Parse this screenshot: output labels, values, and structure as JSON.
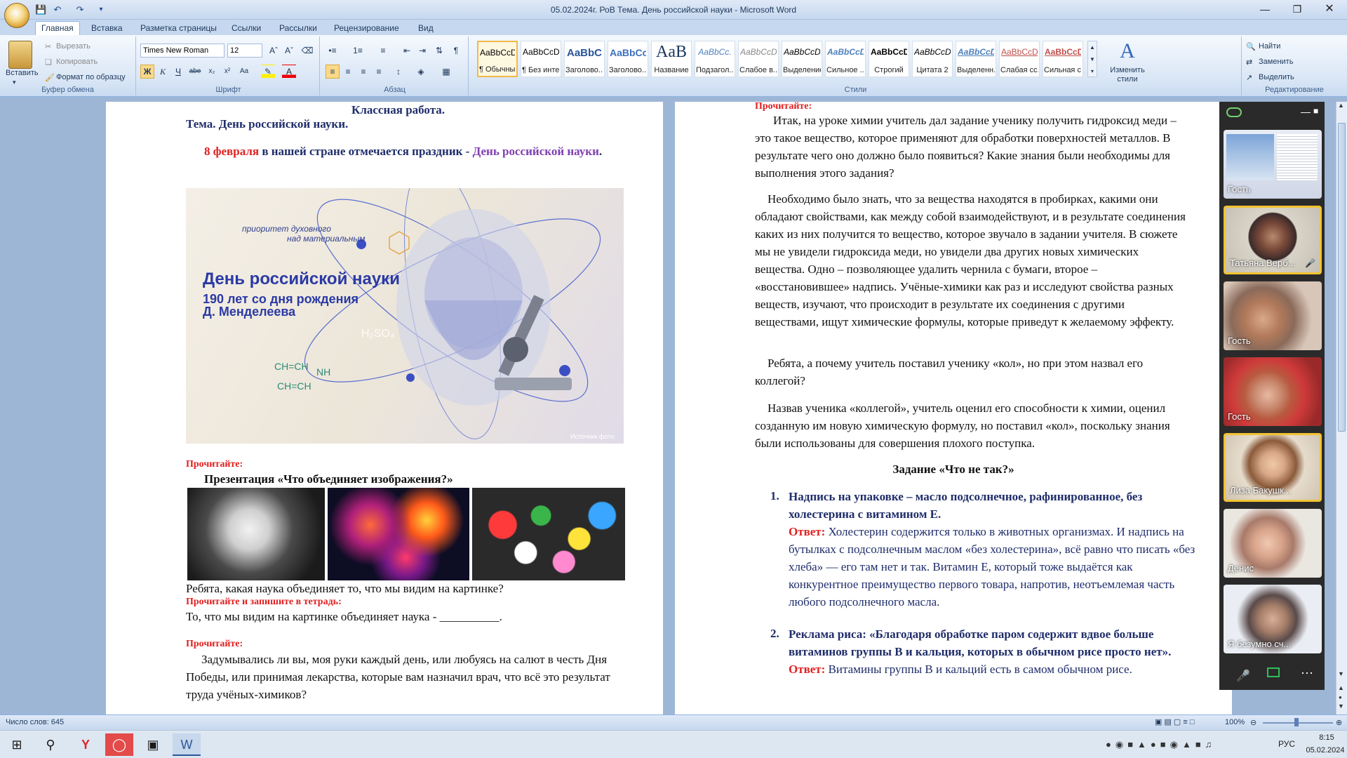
{
  "window": {
    "title": "05.02.2024г. РоВ Тема. День российской науки - Microsoft Word"
  },
  "qat": {
    "save_icon": "save-icon",
    "undo_icon": "undo-icon",
    "redo_icon": "redo-icon"
  },
  "tabs": [
    "Главная",
    "Вставка",
    "Разметка страницы",
    "Ссылки",
    "Рассылки",
    "Рецензирование",
    "Вид"
  ],
  "ribbon": {
    "clipboard": {
      "label": "Буфер обмена",
      "paste": "Вставить",
      "cut": "Вырезать",
      "copy": "Копировать",
      "format": "Формат по образцу"
    },
    "font": {
      "label": "Шрифт",
      "name": "Times New Roman",
      "size": "12"
    },
    "paragraph": {
      "label": "Абзац"
    },
    "styles": {
      "label": "Стили",
      "items": [
        {
          "sample": "AaBbCcDc",
          "name": "¶ Обычный"
        },
        {
          "sample": "AaBbCcDc",
          "name": "¶ Без инте..."
        },
        {
          "sample": "AaBbC",
          "name": "Заголово..."
        },
        {
          "sample": "AaBbCc",
          "name": "Заголово..."
        },
        {
          "sample": "AaB",
          "name": "Название"
        },
        {
          "sample": "AaBbCc.",
          "name": "Подзагол..."
        },
        {
          "sample": "AaBbCcDc",
          "name": "Слабое в..."
        },
        {
          "sample": "AaBbCcDc",
          "name": "Выделение"
        },
        {
          "sample": "AaBbCcDc",
          "name": "Сильное ..."
        },
        {
          "sample": "AaBbCcDc",
          "name": "Строгий"
        },
        {
          "sample": "AaBbCcDc",
          "name": "Цитата 2"
        },
        {
          "sample": "AaBbCcDc",
          "name": "Выделенн..."
        },
        {
          "sample": "AaBbCcDc",
          "name": "Слабая сс..."
        },
        {
          "sample": "AaBbCcDc",
          "name": "Сильная с..."
        }
      ],
      "change": "Изменить стили"
    },
    "editing": {
      "label": "Редактирование",
      "find": "Найти",
      "replace": "Заменить",
      "select": "Выделить"
    }
  },
  "left_page": {
    "line1": "Классная работа.",
    "line2": "Тема. День российской науки.",
    "p1_red": "8 февраля",
    "p1_mid": " в нашей стране отмечается праздник - ",
    "p1_purple_a": "День российской",
    "p1_purple_b": "науки",
    "p1_end": ".",
    "poster": {
      "tag1": "приоритет духовного",
      "tag2": "над материальным",
      "title": "День российской науки",
      "sub1": "190 лет со дня рождения",
      "sub2": "Д. Менделеева",
      "formula1": "CH=CH",
      "formula2": "CH=CH",
      "formula3": "NH",
      "formula4": "H₂SO₄",
      "credit": "Источник фото:"
    },
    "read1": "Прочитайте:",
    "present": "Презентация «Что объединяет изображения?»",
    "q1": "Ребята, какая наука объединяет то, что мы видим на картинке?",
    "read2": "Прочитайте и запишите в тетрадь:",
    "q2": "То, что мы видим на картинке объединяет наука - __________.",
    "read3": "Прочитайте:",
    "p_last": "Задумывались ли вы, моя руки каждый день, или любуясь на салют в честь Дня Победы, или принимая лекарства, которые вам назначил врач, что всё это результат труда учёных-химиков?"
  },
  "right_page": {
    "read": "Прочитайте:",
    "p1": "Итак, на уроке химии учитель дал задание ученику получить гидроксид меди – это такое вещество, которое применяют для обработки поверхностей металлов. В результате чего оно должно было появиться? Какие знания были необходимы для выполнения этого задания?",
    "p2": "Необходимо было знать, что за вещества находятся в пробирках, какими они обладают свойствами, как между собой взаимодействуют, и в результате соединения каких из них получится то вещество, которое звучало в задании учителя. В сюжете мы не увидели гидроксида меди, но увидели два других новых химических вещества. Одно – позволяющее удалить чернила с бумаги, второе – «восстановившее» надпись. Учёные-химики как раз и исследуют свойства разных веществ, изучают, что происходит в результате их соединения с другими веществами, ищут химические формулы, которые приведут к желаемому эффекту.",
    "p3": "Ребята, а почему учитель поставил ученику «кол», но при этом назвал его коллегой?",
    "p4": "Назвав ученика «коллегой», учитель оценил его способности к химии, оценил созданную им новую химическую формулу, но поставил «кол», поскольку знания были использованы для совершения плохого поступка.",
    "task_title": "Задание «Что не так?»",
    "item1_num": "1.",
    "item1": "Надпись на упаковке – масло подсолнечное, рафинированное, без холестерина с витамином Е.",
    "answer_label": "Ответ:",
    "item1_ans": " Холестерин содержится только в животных организмах. И надпись на бутылках с подсолнечным маслом «без холестерина», всё равно что писать «без хлеба» — его там нет и так. Витамин Е, который тоже выдаётся как конкурентное преимущество первого товара, напротив, неотъемлемая часть любого подсолнечного масла.",
    "item2_num": "2.",
    "item2": "Реклама риса: «Благодаря обработке паром содержит вдвое больше витаминов группы В и кальция, которых в обычном рисе просто нет».",
    "answer_label2": "Ответ:",
    "item2_ans": " Витамины группы В и кальций есть в самом обычном рисе."
  },
  "video_panel": {
    "participants": [
      {
        "name": "Гость"
      },
      {
        "name": "Татьяна Верб..."
      },
      {
        "name": "Гость"
      },
      {
        "name": "Гость"
      },
      {
        "name": "Лиза Бакушк..."
      },
      {
        "name": "Денис"
      },
      {
        "name": "Я безумно сч..."
      }
    ]
  },
  "statusbar": {
    "words": "Число слов: 645",
    "zoom": "100%"
  },
  "taskbar": {
    "lang": "РУС",
    "time": "8:15",
    "date": "05.02.2024"
  }
}
